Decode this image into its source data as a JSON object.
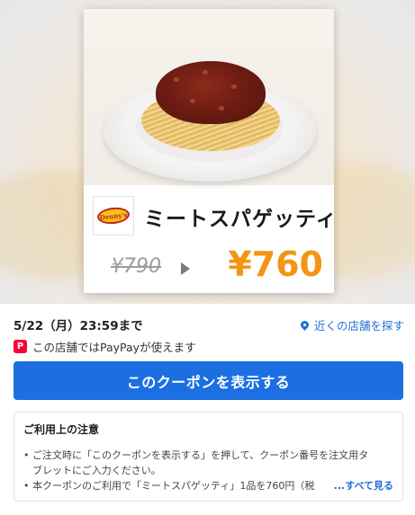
{
  "product": {
    "name": "ミートスパゲッティ",
    "old_price": "¥790",
    "new_price": "¥760",
    "brand_logo_text": "Denny's"
  },
  "info": {
    "deadline": "5/22（月）23:59まで",
    "nearby_label": "近くの店舗を探す",
    "paypay_icon_text": "P",
    "paypay_text": "この店舗ではPayPayが使えます"
  },
  "actions": {
    "show_coupon_label": "このクーポンを表示する"
  },
  "notes": {
    "title": "ご利用上の注意",
    "line1a": "ご注文時に「このクーポンを表示する」を押して、クーポン番号を注文用タ",
    "line1b": "ブレットにご入力ください。",
    "line2": "本クーポンのご利用で「ミートスパゲッティ」1品を760円（税",
    "more_label": "...すべて見る"
  },
  "colors": {
    "accent_blue": "#1b6fe0",
    "price_orange": "#f39512",
    "paypay_red": "#ff0033"
  },
  "icons": {
    "location": "map-pin-icon",
    "paypay": "paypay-icon",
    "arrow": "arrow-right-icon"
  }
}
